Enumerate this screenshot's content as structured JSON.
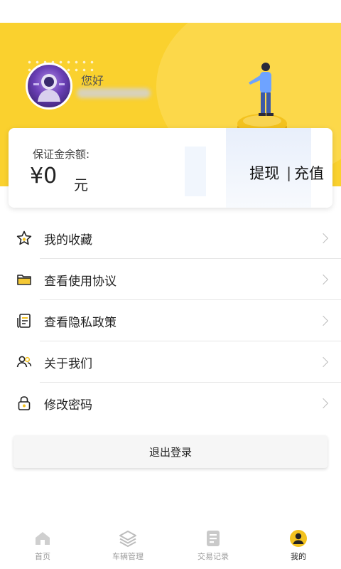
{
  "profile": {
    "greeting": "您好"
  },
  "balance": {
    "label": "保证金余额:",
    "amount": "¥0",
    "unit": "元",
    "withdraw_label": "提现",
    "separator": "|",
    "recharge_label": "充值"
  },
  "menu": {
    "items": [
      {
        "label": "我的收藏",
        "icon": "star-icon"
      },
      {
        "label": "查看使用协议",
        "icon": "folder-icon"
      },
      {
        "label": "查看隐私政策",
        "icon": "document-icon"
      },
      {
        "label": "关于我们",
        "icon": "users-icon"
      },
      {
        "label": "修改密码",
        "icon": "lock-icon"
      }
    ]
  },
  "logout": {
    "label": "退出登录"
  },
  "tabbar": {
    "items": [
      {
        "label": "首页",
        "icon": "home-icon",
        "active": false
      },
      {
        "label": "车辆管理",
        "icon": "layers-icon",
        "active": false
      },
      {
        "label": "交易记录",
        "icon": "list-icon",
        "active": false
      },
      {
        "label": "我的",
        "icon": "user-icon",
        "active": true
      }
    ]
  },
  "colors": {
    "brand_yellow": "#fad12e",
    "coin": "#f3c21e",
    "text_primary": "#222222",
    "text_muted": "#9a9a9a"
  }
}
